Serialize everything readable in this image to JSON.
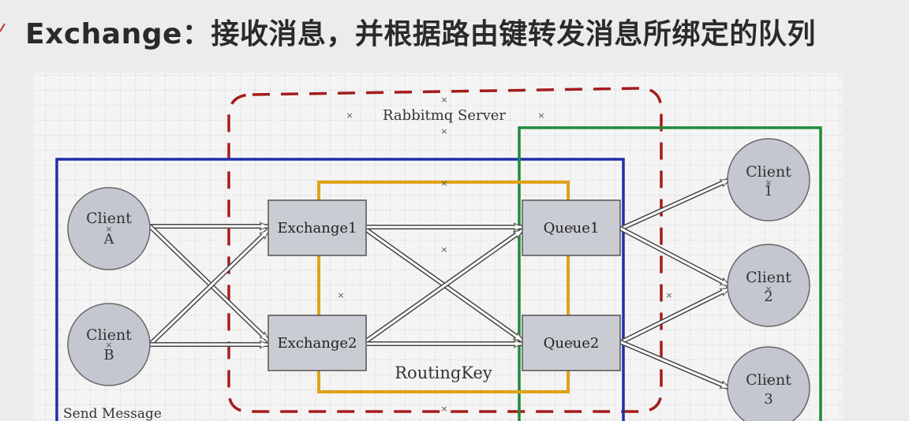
{
  "slide": {
    "title": "Exchange：接收消息，并根据路由键转发消息所绑定的队列"
  },
  "diagram": {
    "server_label": "Rabbitmq Server",
    "send_message_label": "Send Message",
    "routing_key_label": "RoutingKey",
    "clients_left": [
      {
        "line1": "Client",
        "line2": "A"
      },
      {
        "line1": "Client",
        "line2": "B"
      }
    ],
    "exchanges": [
      "Exchange1",
      "Exchange2"
    ],
    "queues": [
      "Queue1",
      "Queue2"
    ],
    "clients_right": [
      {
        "line1": "Client",
        "line2": "1"
      },
      {
        "line1": "Client",
        "line2": "2"
      },
      {
        "line1": "Client",
        "line2": "3"
      }
    ],
    "colors": {
      "blue_frame": "#1f2fa8",
      "orange_frame": "#e0a21a",
      "green_frame": "#1e8a3a",
      "red_dashed": "#a51c1c",
      "node_fill": "#c9ccd3",
      "circle_fill": "#c4c7cf",
      "grid": "#c9c9c9"
    }
  }
}
